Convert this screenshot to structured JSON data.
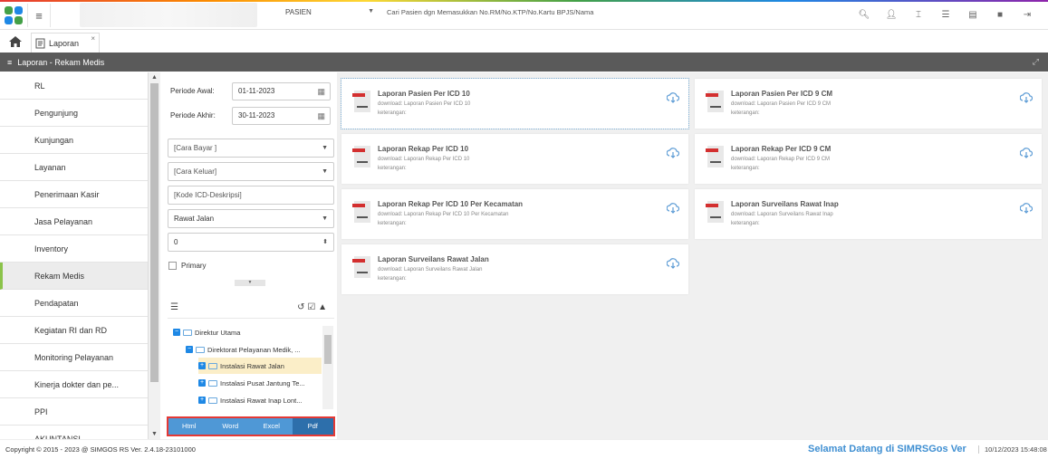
{
  "header": {
    "patient_type": "PASIEN",
    "search_placeholder": "Cari Pasien dgn Memasukkan No.RM/No.KTP/No.Kartu BPJS/Nama",
    "icons": [
      "search-icon",
      "user-icon",
      "text-icon",
      "list-icon",
      "document-icon",
      "folder-icon",
      "logout-icon"
    ]
  },
  "tabs": [
    {
      "label": "Laporan",
      "close": "×"
    }
  ],
  "title": "Laporan - Rekam Medis",
  "sidebar": {
    "items": [
      {
        "label": "RL"
      },
      {
        "label": "Pengunjung"
      },
      {
        "label": "Kunjungan"
      },
      {
        "label": "Layanan"
      },
      {
        "label": "Penerimaan Kasir"
      },
      {
        "label": "Jasa Pelayanan"
      },
      {
        "label": "Inventory"
      },
      {
        "label": "Rekam Medis"
      },
      {
        "label": "Pendapatan"
      },
      {
        "label": "Kegiatan RI dan RD"
      },
      {
        "label": "Monitoring Pelayanan"
      },
      {
        "label": "Kinerja dokter dan pe..."
      },
      {
        "label": "PPI"
      },
      {
        "label": "AKUNTANSI"
      }
    ],
    "active": "Rekam Medis"
  },
  "filter": {
    "periode_awal_label": "Periode Awal:",
    "periode_awal": "01-11-2023",
    "periode_akhir_label": "Periode Akhir:",
    "periode_akhir": "30-11-2023",
    "cara_bayar": "[Cara Bayar ]",
    "cara_keluar": "[Cara Keluar]",
    "kode_icd": "[Kode ICD-Deskripsi]",
    "jenis": "Rawat Jalan",
    "number": "0",
    "primary_label": "Primary"
  },
  "tree": [
    {
      "label": "Direktur Utama"
    },
    {
      "label": "Direktorat Pelayanan Medik, ..."
    },
    {
      "label": "Instalasi Rawat Jalan"
    },
    {
      "label": "Instalasi Pusat Jantung Te..."
    },
    {
      "label": "Instalasi Rawat Inap Lont..."
    }
  ],
  "export": {
    "html": "Html",
    "word": "Word",
    "excel": "Excel",
    "pdf": "Pdf"
  },
  "reports": [
    {
      "title": "Laporan Pasien Per ICD 10",
      "download": "download: Laporan Pasien Per ICD 10",
      "ket": "keterangan:"
    },
    {
      "title": "Laporan Pasien Per ICD 9 CM",
      "download": "download: Laporan Pasien Per ICD 9 CM",
      "ket": "keterangan:"
    },
    {
      "title": "Laporan Rekap Per ICD 10",
      "download": "download: Laporan Rekap Per ICD 10",
      "ket": "keterangan:"
    },
    {
      "title": "Laporan Rekap Per ICD 9 CM",
      "download": "download: Laporan Rekap Per ICD 9 CM",
      "ket": "keterangan:"
    },
    {
      "title": "Laporan Rekap Per ICD 10 Per Kecamatan",
      "download": "download: Laporan Rekap Per ICD 10 Per Kecamatan",
      "ket": "keterangan:"
    },
    {
      "title": "Laporan Surveilans Rawat Inap",
      "download": "download: Laporan Surveilans Rawat Inap",
      "ket": "keterangan:"
    },
    {
      "title": "Laporan Surveilans Rawat Jalan",
      "download": "download: Laporan Surveilans Rawat Jalan",
      "ket": "keterangan:"
    }
  ],
  "footer": {
    "copyright": "Copyright © 2015 - 2023 @ SIMGOS RS Ver. 2.4.18-23101000",
    "welcome": "Selamat Datang di SIMRSGos Ver",
    "datetime": "10/12/2023 15:48:08"
  }
}
